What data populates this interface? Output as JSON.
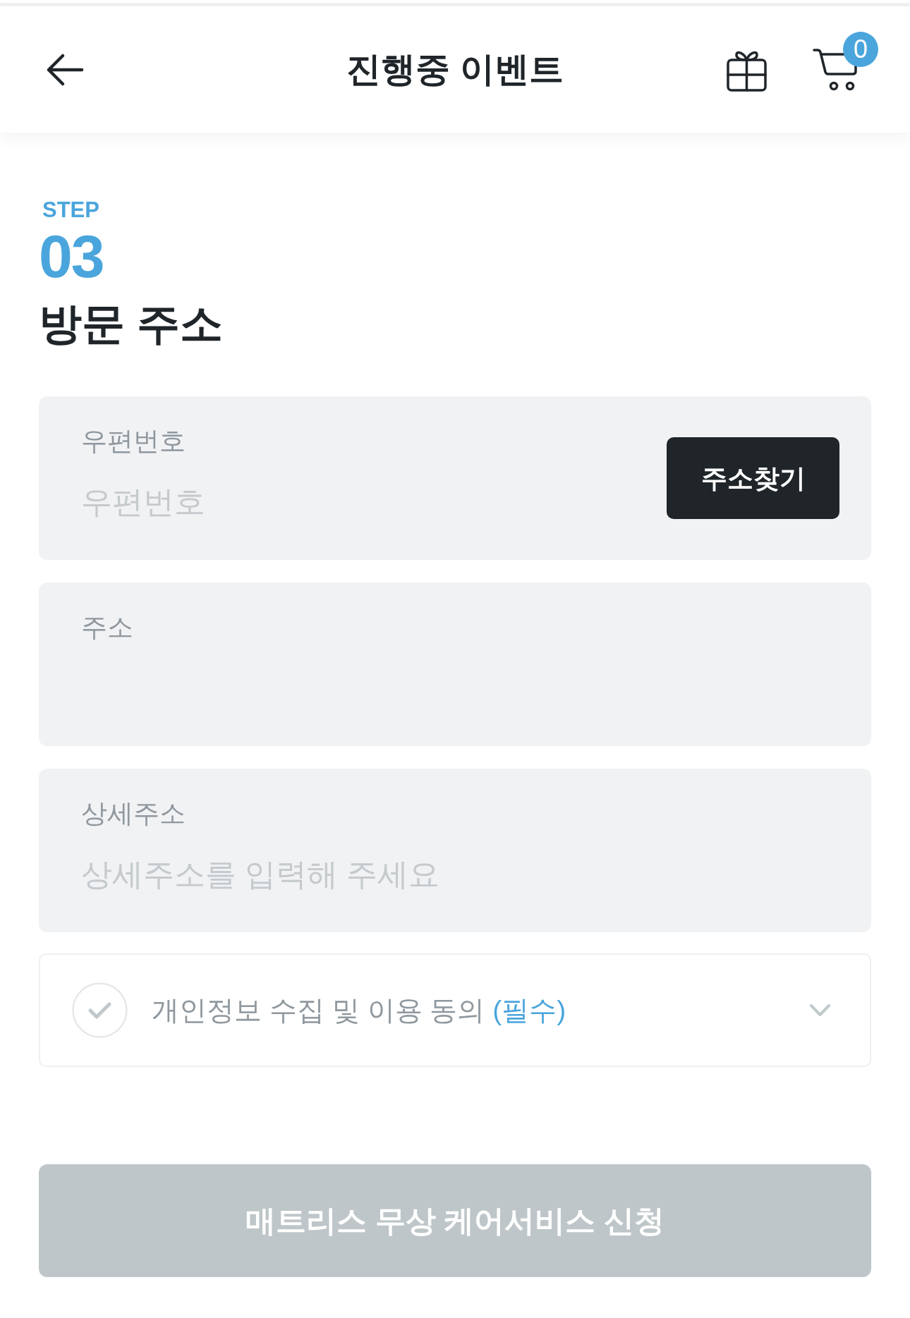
{
  "header": {
    "title": "진행중 이벤트",
    "cart_count": "0"
  },
  "step": {
    "label": "STEP",
    "number": "03",
    "title": "방문 주소"
  },
  "fields": [
    {
      "kind": "search",
      "label": "우편번호",
      "placeholder": "우편번호",
      "button": "주소찾기"
    },
    {
      "kind": "text",
      "label": "주소"
    },
    {
      "kind": "text",
      "label": "상세주소",
      "placeholder": "상세주소를 입력해 주세요"
    }
  ],
  "agreement": {
    "text": "개인정보 수집 및 이용 동의",
    "required": "(필수)",
    "checked": false,
    "expanded": false
  },
  "submit": {
    "label": "매트리스 무상 케어서비스 신청",
    "disabled": true
  }
}
